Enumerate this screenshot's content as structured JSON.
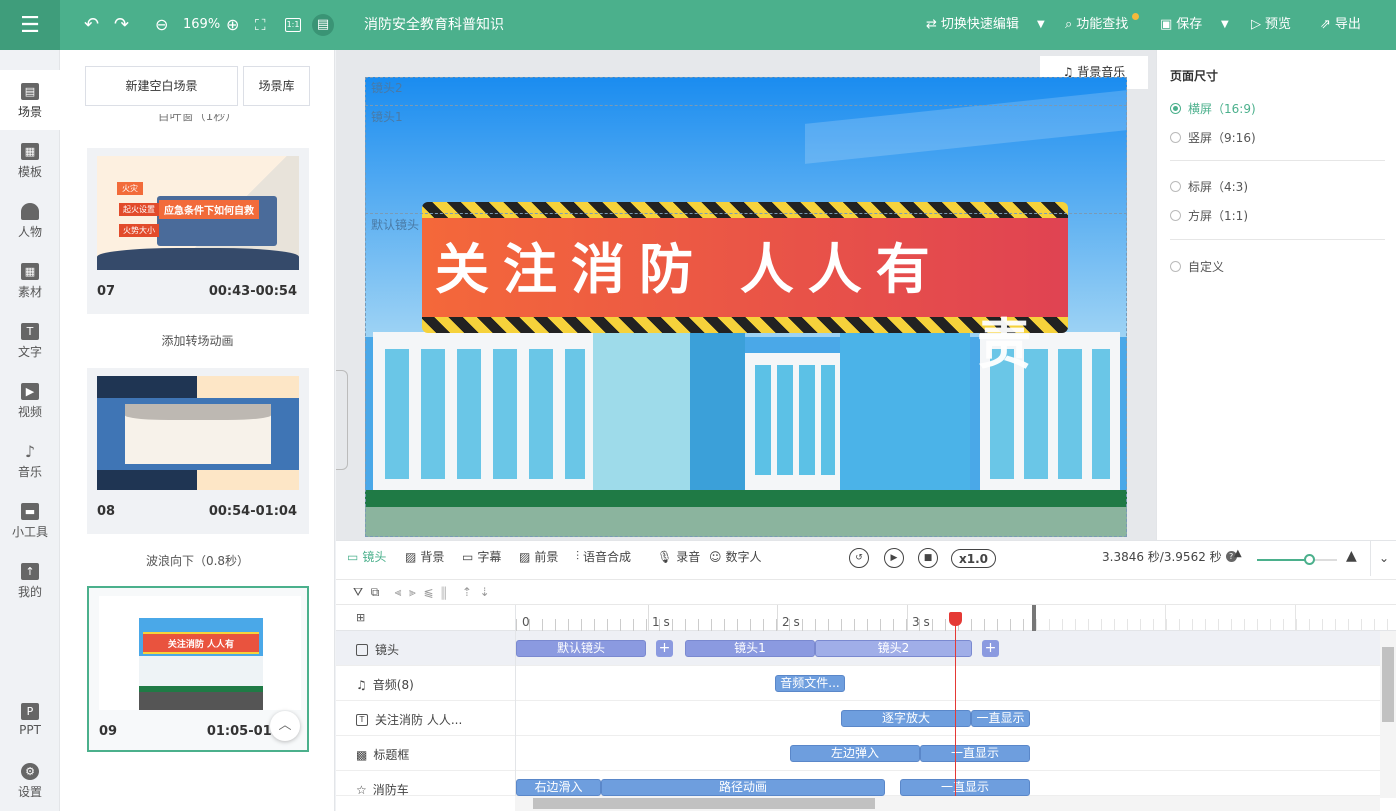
{
  "toolbar": {
    "zoom": "169%",
    "project_title": "消防安全教育科普知识",
    "quick_edit": "切换快速编辑",
    "feature_search": "功能查找",
    "save": "保存",
    "preview": "预览",
    "export": "导出",
    "fit_label": "1:1"
  },
  "left_nav": [
    {
      "label": "场景",
      "icon": "scene-icon"
    },
    {
      "label": "模板",
      "icon": "template-icon"
    },
    {
      "label": "人物",
      "icon": "person-icon"
    },
    {
      "label": "素材",
      "icon": "material-icon"
    },
    {
      "label": "文字",
      "icon": "text-icon"
    },
    {
      "label": "视频",
      "icon": "video-icon"
    },
    {
      "label": "音乐",
      "icon": "music-icon"
    },
    {
      "label": "小工具",
      "icon": "toolbox-icon"
    },
    {
      "label": "我的",
      "icon": "my-icon"
    },
    {
      "label": "PPT",
      "icon": "ppt-icon"
    },
    {
      "label": "设置",
      "icon": "settings-icon"
    }
  ],
  "scene_panel": {
    "new_scene": "新建空白场景",
    "library": "场景库",
    "cut_label": "百叶窗（1秒）",
    "cards": [
      {
        "num": "07",
        "time": "00:43-00:54",
        "transition": "添加转场动画",
        "thumb_text": [
          "火灾",
          "起火设置",
          "应急条件下如何自救",
          "火势大小"
        ]
      },
      {
        "num": "08",
        "time": "00:54-01:04",
        "transition": "波浪向下（0.8秒）"
      },
      {
        "num": "09",
        "time": "01:05-01:09",
        "thumb_text": [
          "关注消防 人人有"
        ]
      }
    ]
  },
  "canvas": {
    "bg_music": "背景音乐",
    "cam_labels": [
      "镜头2",
      "镜头1",
      "默认镜头"
    ],
    "banner_text": "关注消防  人人有",
    "banner_overflow": "责"
  },
  "right_panel": {
    "title": "页面尺寸",
    "options": [
      {
        "label": "横屏（16:9)",
        "selected": true
      },
      {
        "label": "竖屏（9:16)",
        "selected": false
      },
      {
        "label": "标屏（4:3)",
        "selected": false
      },
      {
        "label": "方屏（1:1)",
        "selected": false
      },
      {
        "label": "自定义",
        "selected": false
      }
    ]
  },
  "timeline": {
    "tabs": [
      "镜头",
      "背景",
      "字幕",
      "前景",
      "语音合成",
      "录音",
      "数字人"
    ],
    "speed": "x1.0",
    "time_readout": "3.3846 秒/3.9562 秒",
    "ticks": [
      "0",
      "1 s",
      "2 s",
      "3 s"
    ],
    "tracks": [
      {
        "label": "镜头",
        "clips": [
          "默认镜头",
          "镜头1",
          "镜头2"
        ]
      },
      {
        "label": "音频(8)",
        "clips": [
          "音频文件..."
        ]
      },
      {
        "label": "关注消防 人人...",
        "clips": [
          "逐字放大",
          "一直显示"
        ]
      },
      {
        "label": "标题框",
        "clips": [
          "左边弹入",
          "一直显示"
        ]
      },
      {
        "label": "消防车",
        "clips": [
          "右边滑入",
          "路径动画",
          "一直显示"
        ]
      }
    ]
  }
}
